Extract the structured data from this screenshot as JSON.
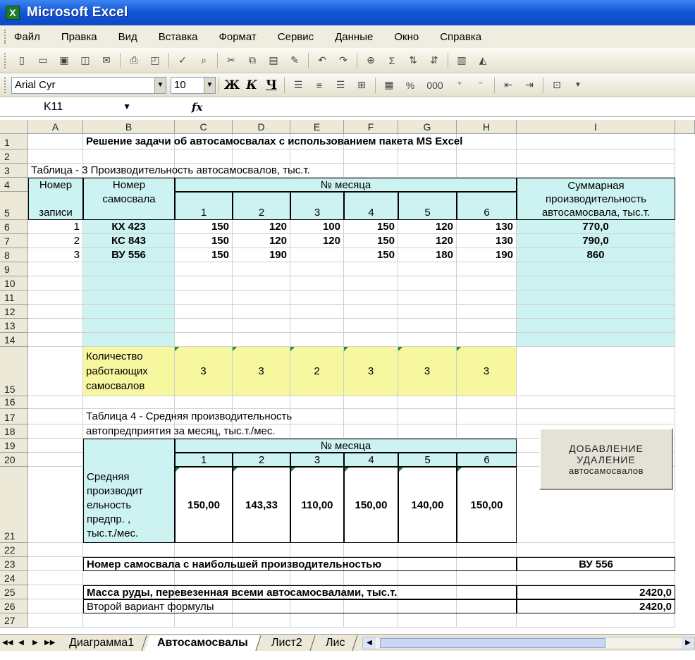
{
  "window": {
    "title": "Microsoft Excel",
    "icon": "excel-icon"
  },
  "menu": [
    "Файл",
    "Правка",
    "Вид",
    "Вставка",
    "Формат",
    "Сервис",
    "Данные",
    "Окно",
    "Справка"
  ],
  "format_toolbar": {
    "font": "Arial Cyr",
    "size": "10",
    "bold": "Ж",
    "italic": "К",
    "underline": "Ч",
    "percent": "%",
    "thousands": "000"
  },
  "formula_bar": {
    "name_box": "K11",
    "fx": "fx",
    "value": ""
  },
  "columns": [
    "A",
    "B",
    "C",
    "D",
    "E",
    "F",
    "G",
    "H",
    "I"
  ],
  "rows": [
    "1",
    "2",
    "3",
    "4",
    "5",
    "6",
    "7",
    "8",
    "9",
    "10",
    "11",
    "12",
    "13",
    "14",
    "15",
    "16",
    "17",
    "18",
    "19",
    "20",
    "21",
    "22",
    "23",
    "24",
    "25",
    "26",
    "27"
  ],
  "sheet": {
    "title": "Решение задачи об автосамосвалах с использованием пакета MS Excel",
    "table3_caption": "Таблица - 3 Производительность автосамосвалов, тыс.т.",
    "hdr_num_a": "Номер",
    "hdr_num_b": "записи",
    "hdr_truck_a": "Номер",
    "hdr_truck_b": "самосвала",
    "hdr_month": "№ месяца",
    "months": [
      "1",
      "2",
      "3",
      "4",
      "5",
      "6"
    ],
    "hdr_sum": "Суммарная производительность автосамосвала, тыс.т.",
    "hdr_sum_lines": [
      "Суммарная",
      "производительность",
      "автосамосвала, тыс.т."
    ],
    "trucks": [
      {
        "n": "1",
        "id": "КХ  423",
        "m": [
          "150",
          "120",
          "100",
          "150",
          "120",
          "130"
        ],
        "total": "770,0"
      },
      {
        "n": "2",
        "id": "КС 843",
        "m": [
          "150",
          "120",
          "120",
          "150",
          "120",
          "130"
        ],
        "total": "790,0"
      },
      {
        "n": "3",
        "id": "ВУ 556",
        "m": [
          "150",
          "190",
          "",
          "150",
          "180",
          "190"
        ],
        "total": "860"
      }
    ],
    "count_label_lines": [
      "Количество",
      "работающих",
      "самосвалов"
    ],
    "counts": [
      "3",
      "3",
      "2",
      "3",
      "3",
      "3"
    ],
    "table4_line1": "Таблица 4 - Средняя производительность",
    "table4_line2": "автопредприятия за месяц, тыс.т./мес.",
    "table4_month": "№ месяца",
    "avg_label_lines": [
      "Средняя",
      "производит",
      "ельность",
      "предпр. ,",
      "тыс.т./мес."
    ],
    "avg": [
      "150,00",
      "143,33",
      "110,00",
      "150,00",
      "140,00",
      "150,00"
    ],
    "best_label": "Номер самосвала с наибольшей производительностью",
    "best_value": "ВУ 556",
    "mass_label": "Масса руды, перевезенная всеми автосамосвалами, тыс.т.",
    "mass_value": "2420,0",
    "alt_label": "Второй вариант формулы",
    "alt_value": "2420,0"
  },
  "macro_button": {
    "line1": "ДОБАВЛЕНИЕ",
    "line2": "УДАЛЕНИЕ",
    "line3": "автосамосвалов"
  },
  "sheet_tabs": [
    "Диаграмма1",
    "Автосамосвалы",
    "Лист2",
    "Лис"
  ],
  "active_tab": "Автосамосвалы"
}
